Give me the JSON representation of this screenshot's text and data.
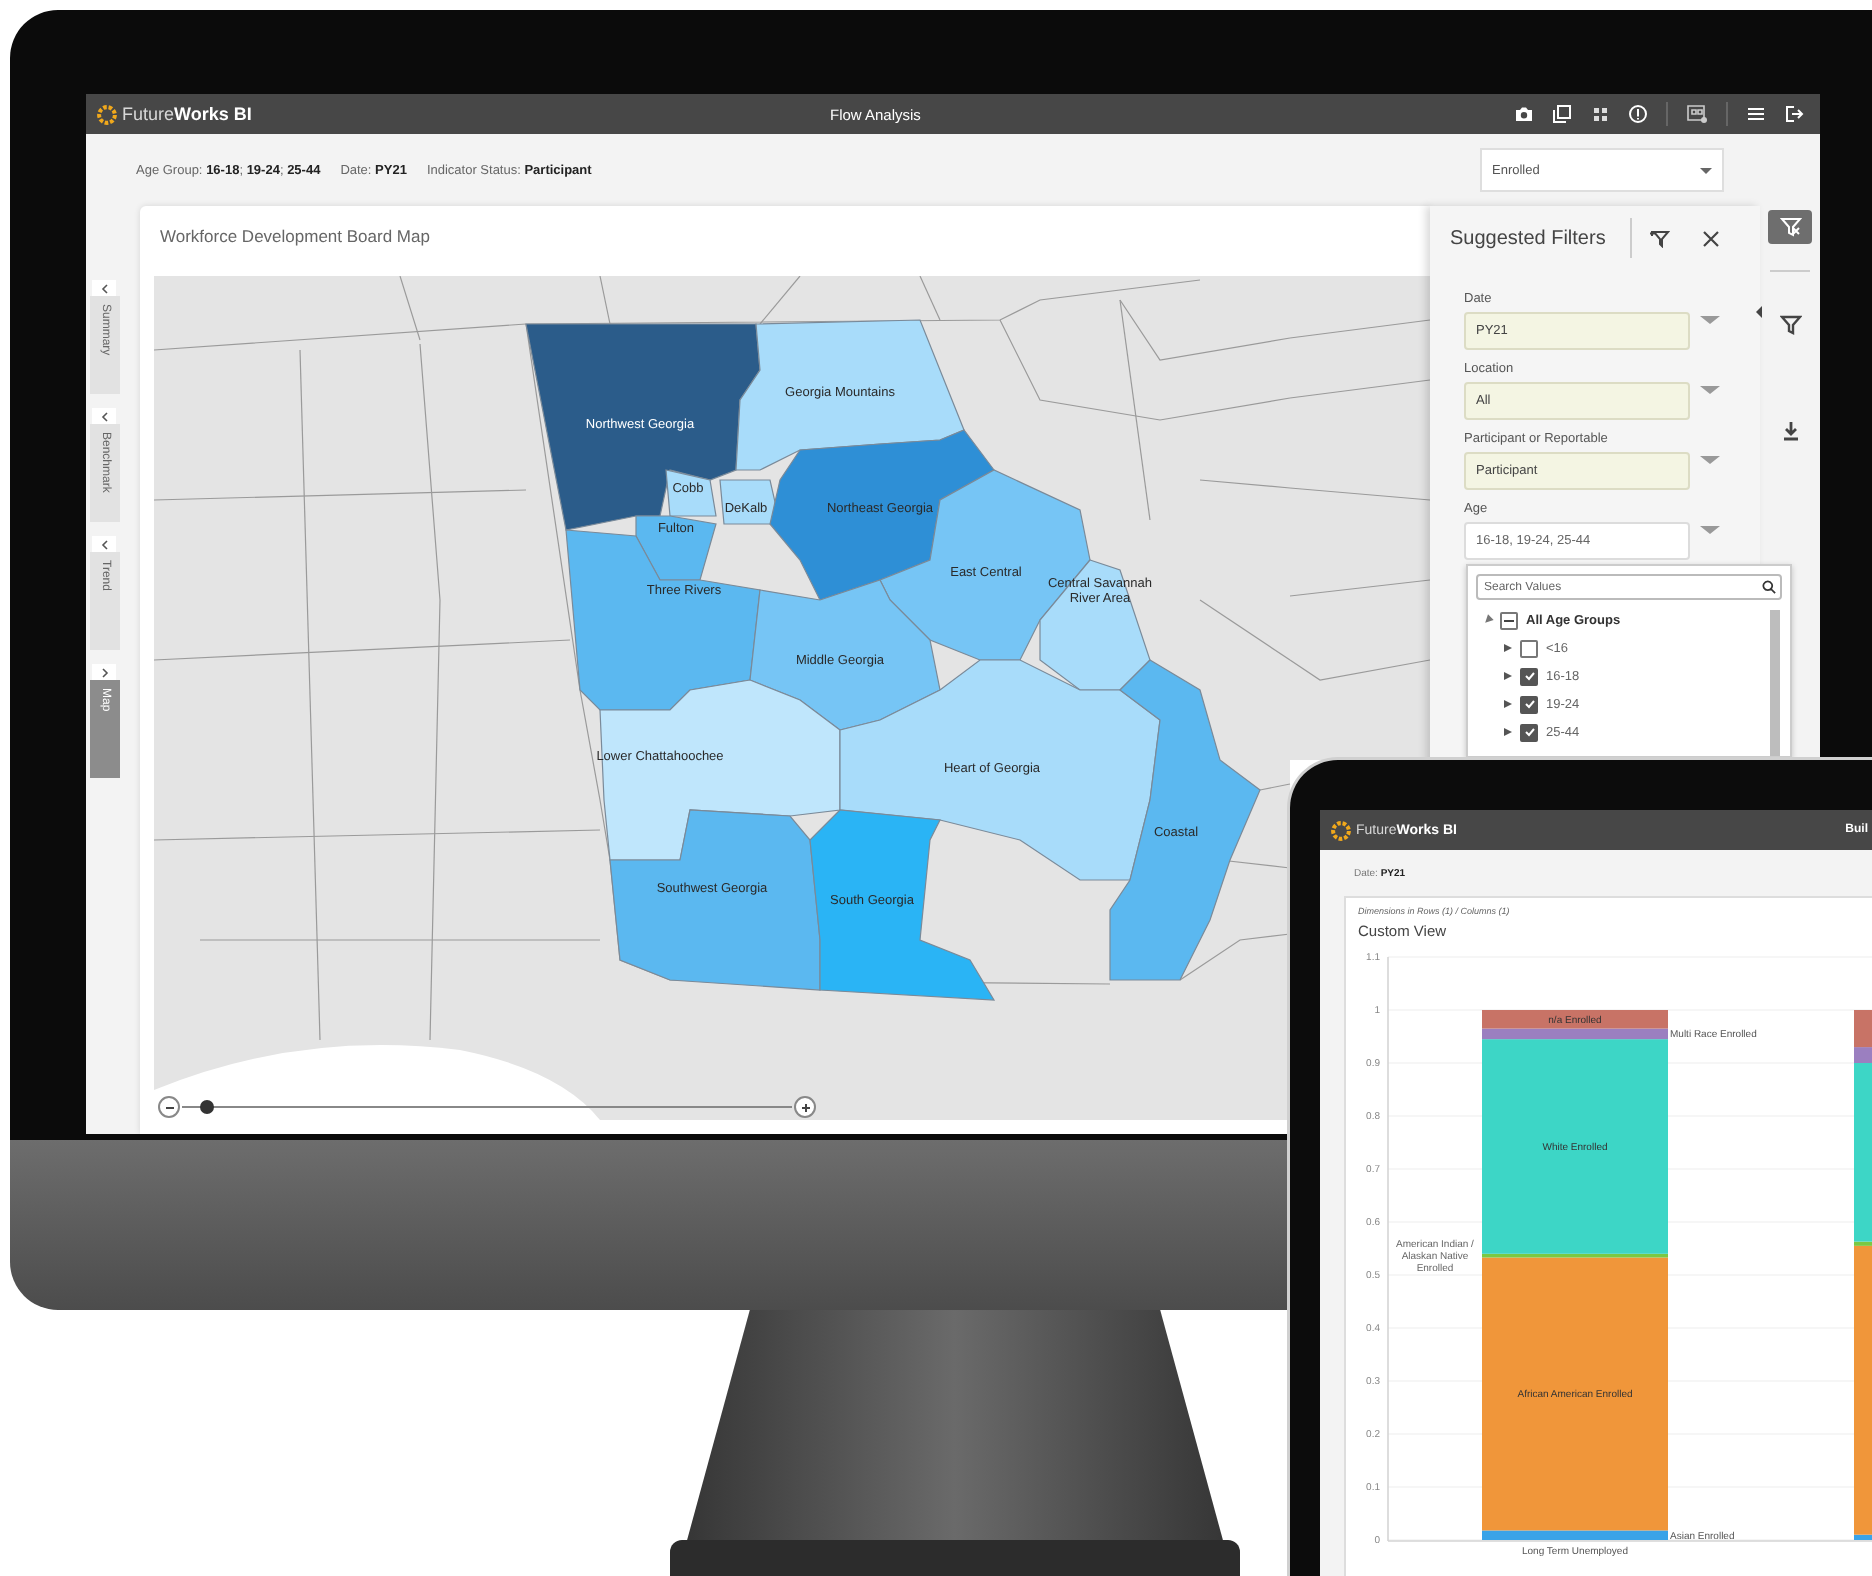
{
  "monitor": {
    "app_bar": {
      "logo": "Future**Works BI**",
      "title": "Flow Analysis"
    },
    "filter_summary": [
      "Age Group: **16-18**; **19-24**; **25-44**",
      "Date: **PY21**",
      "Indicator Status: **Participant**"
    ],
    "measure_dropdown": {
      "value": "Enrolled"
    },
    "side_tabs": [
      {
        "label": "Summary",
        "selected": false
      },
      {
        "label": "Benchmark",
        "selected": false
      },
      {
        "label": "Trend",
        "selected": false
      },
      {
        "label": "Map",
        "selected": true
      }
    ],
    "map_card": {
      "title": "Workforce Development Board Map",
      "zoom": {
        "level": 0.04
      },
      "regions": [
        {
          "name": "Northwest Georgia",
          "color": "#2b5c8a"
        },
        {
          "name": "Georgia Mountains",
          "color": "#a8dcfa"
        },
        {
          "name": "Cobb",
          "color": "#a8dcfa"
        },
        {
          "name": "DeKalb",
          "color": "#a8dcfa"
        },
        {
          "name": "Fulton",
          "color": "#5bb8f0"
        },
        {
          "name": "Northeast Georgia",
          "color": "#2e8fd6"
        },
        {
          "name": "Three Rivers",
          "color": "#5bb8f0"
        },
        {
          "name": "East Central",
          "color": "#76c5f5"
        },
        {
          "name": "Central Savannah River Area",
          "color": "#a8dcfa"
        },
        {
          "name": "Middle Georgia",
          "color": "#76c5f5"
        },
        {
          "name": "Lower Chattahoochee",
          "color": "#bfe6fc"
        },
        {
          "name": "Heart of Georgia",
          "color": "#a8dcfa"
        },
        {
          "name": "Coastal",
          "color": "#5bb8f0"
        },
        {
          "name": "Southwest Georgia",
          "color": "#5bb8f0"
        },
        {
          "name": "South Georgia",
          "color": "#2ab4f5"
        }
      ]
    },
    "suggested_filters": {
      "title": "Suggested Filters",
      "filters": [
        {
          "label": "Date",
          "value": "PY21",
          "kind": "select"
        },
        {
          "label": "Location",
          "value": "All",
          "kind": "select"
        },
        {
          "label": "Participant or Reportable",
          "value": "Participant",
          "kind": "select"
        },
        {
          "label": "Age",
          "value": "16-18, 19-24, 25-44",
          "kind": "multi"
        }
      ],
      "value_search": {
        "placeholder": "Search Values"
      },
      "tree": [
        {
          "label": "All Age Groups",
          "indeterminate": true,
          "expanded": true,
          "children": [
            {
              "label": "<16",
              "checked": false,
              "expanded": false
            },
            {
              "label": "16-18",
              "checked": true,
              "expanded": false
            },
            {
              "label": "19-24",
              "checked": true,
              "expanded": false
            },
            {
              "label": "25-44",
              "checked": true,
              "expanded": false
            }
          ]
        }
      ]
    },
    "rail": [
      {
        "kind": "clear-filter",
        "active": true
      },
      {
        "kind": "filter",
        "active": false
      },
      {
        "kind": "download",
        "active": false
      }
    ]
  },
  "tablet": {
    "app_bar": {
      "logo": "Future**Works BI**",
      "title": "Buil"
    },
    "filter_summary": [
      "Date: **PY21**"
    ],
    "card": {
      "note": "Dimensions in Rows (1) / Columns (1)",
      "chart_data": {
        "type": "bar",
        "title": "Custom View",
        "stacked": true,
        "grid": true,
        "categories": [
          "Long Term Unemployed",
          null
        ],
        "ylim": [
          0,
          1.1
        ],
        "yticks": [
          0,
          0.1,
          0.2,
          0.3,
          0.4,
          0.5,
          0.6,
          0.7,
          0.8,
          0.9,
          1,
          1.1
        ],
        "series": [
          {
            "name": "Asian Enrolled",
            "color": "#3aa3e8",
            "values": [
              0.018,
              0.01
            ]
          },
          {
            "name": "African American Enrolled",
            "color": "#f0963a",
            "values": [
              0.515,
              0.545
            ]
          },
          {
            "name": "American Indian / Alaskan Native Enrolled",
            "color": "#7ac943",
            "values": [
              0.007,
              0.008
            ]
          },
          {
            "name": "White Enrolled",
            "color": "#3dd6c6",
            "values": [
              0.405,
              0.337
            ]
          },
          {
            "name": "Multi Race Enrolled",
            "color": "#9b7fc0",
            "values": [
              0.02,
              0.03
            ]
          },
          {
            "name": "n/a Enrolled",
            "color": "#c87366",
            "values": [
              0.035,
              0.07
            ]
          }
        ]
      }
    }
  }
}
